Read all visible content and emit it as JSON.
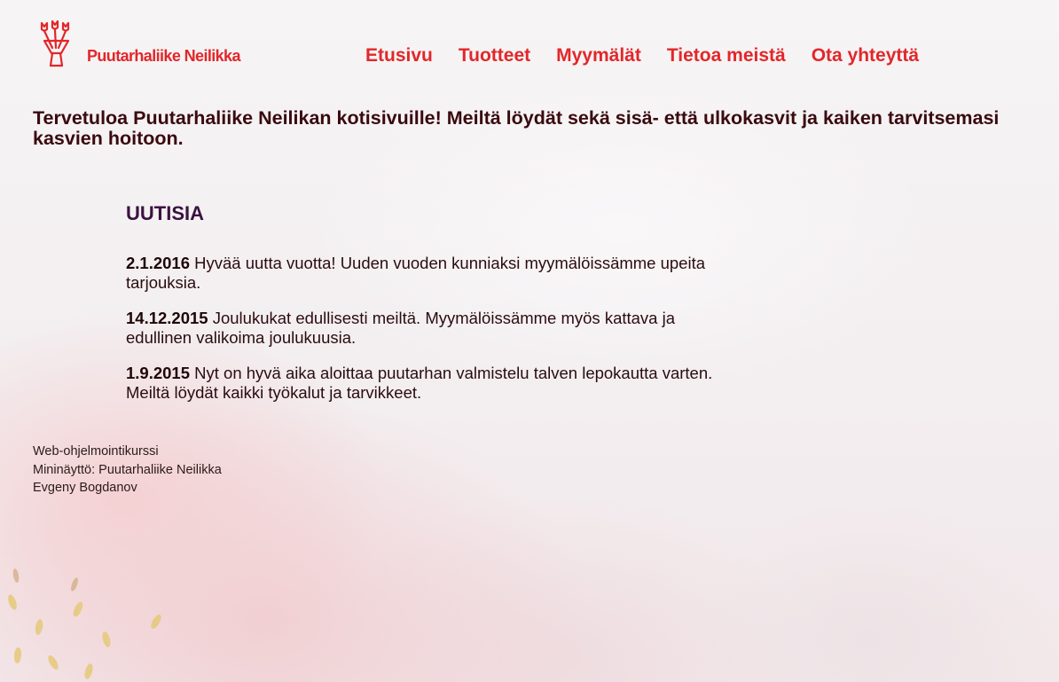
{
  "site": {
    "logo_text": "Puutarhaliike Neilikka",
    "brand_color": "#e2272a"
  },
  "nav": {
    "items": [
      {
        "label": "Etusivu"
      },
      {
        "label": "Tuotteet"
      },
      {
        "label": "Myymälät"
      },
      {
        "label": "Tietoa meistä"
      },
      {
        "label": "Ota yhteyttä"
      }
    ]
  },
  "intro": {
    "text": "Tervetuloa Puutarhaliike Neilikan kotisivuille! Meiltä löydät sekä sisä- että ulkokasvit ja kaiken tarvitsemasi kasvien hoitoon."
  },
  "news": {
    "heading": "UUTISIA",
    "items": [
      {
        "date": "2.1.2016",
        "text": " Hyvää uutta vuotta! Uuden vuoden kunniaksi myymälöissämme upeita tarjouksia."
      },
      {
        "date": "14.12.2015",
        "text": " Joulukukat edullisesti meiltä. Myymälöissämme myös kattava ja edullinen valikoima joulukuusia."
      },
      {
        "date": "1.9.2015",
        "text": " Nyt on hyvä aika aloittaa puutarhan valmistelu talven lepokautta varten. Meiltä löydät kaikki työkalut ja tarvikkeet."
      }
    ]
  },
  "footer": {
    "lines": [
      "Web-ohjelmointikurssi",
      "Mininäyttö: Puutarhaliike Neilikka",
      "Evgeny Bogdanov"
    ]
  },
  "icons": {
    "logo": "tulip-bouquet-icon"
  }
}
